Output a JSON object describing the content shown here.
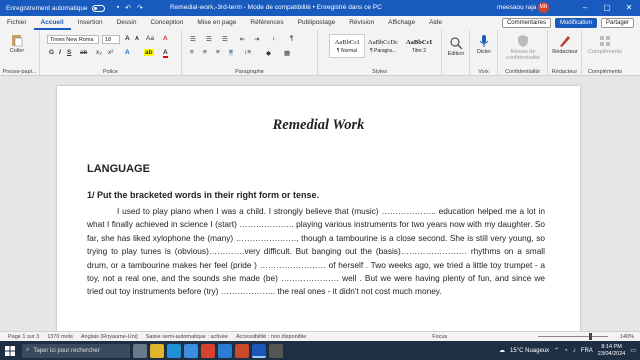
{
  "titlebar": {
    "autosave_label": "Enregistrement automatique",
    "doc_title": "Remedial-work,-3rd-term  -  Mode de compatibilité  •  Enregistré dans ce PC",
    "user": "meesaou raja",
    "avatar_initials": "MR"
  },
  "menu": {
    "tabs": [
      "Fichier",
      "Accueil",
      "Insertion",
      "Dessin",
      "Conception",
      "Mise en page",
      "Références",
      "Publipostage",
      "Révision",
      "Affichage",
      "Aide"
    ],
    "active_index": 1,
    "comments_label": "Commentaires",
    "mode_label": "Modification",
    "share_label": "Partager"
  },
  "ribbon": {
    "paste_label": "Coller",
    "clipboard_group": "Presse-papi...",
    "font_name": "Times New Roma",
    "font_size": "18",
    "font_group": "Police",
    "paragraph_group": "Paragraphe",
    "styles": [
      {
        "preview": "AaBbCcI",
        "name": "¶ Normal"
      },
      {
        "preview": "AaBbCcDc",
        "name": "¶ Paragra..."
      },
      {
        "preview": "AaBbCcI",
        "name": "Titre 2"
      }
    ],
    "styles_group": "Styles",
    "edit_label": "Édition",
    "dictate_label": "Dicter",
    "voice_group": "Voix",
    "sensitivity_label": "Niveau de confidentialité",
    "confidentiality_group": "Confidentialité",
    "editor_label": "Rédacteur",
    "editor_group": "Rédacteur",
    "addins_label": "Compléments",
    "addins_group": "Compléments"
  },
  "document": {
    "title": "Remedial Work",
    "section": "LANGUAGE",
    "question": "1/ Put the bracketed words in their right form or tense.",
    "paragraph": [
      "I used to play piano when I was a child. I strongly believe that (music) ……………….. education helped me a lot in what I finally achieved in science I (start) ……………….. playing various instruments for two years now with my daughter. So far, she has liked xylophone the (many) …………………., though a tambourine is a close second. She is still very young, so trying to play tunes is (obvious)………….very difficult. But banging out the (basis)…………………… rhythms on a small drum, or a tambourine makes her feel (pride ) …………………… of herself . Two weeks ago, we tried a little toy trumpet - a toy, not a real one, and the sounds she made (be) ………………… well . But we were having plenty of fun, and since we tried out toy instruments before (try) ……………….. the real ones - it didn't not cost much money."
    ]
  },
  "status": {
    "page": "Page 1 sur 3",
    "words": "1370 mots",
    "language": "Anglais (Royaume-Uni)",
    "predictive": "Saisie semi-automatique : activée",
    "accessibility": "Accessibilité : non disponible",
    "focus": "Focus",
    "zoom": "140%"
  },
  "taskbar": {
    "search_placeholder": "Taper ici pour rechercher",
    "weather": "15°C  Nuageux",
    "lang": "FRA",
    "time": "8:14 PM",
    "date": "23/04/2024"
  },
  "colors": {
    "accent": "#185abd",
    "taskbar": "#1e2f44"
  }
}
